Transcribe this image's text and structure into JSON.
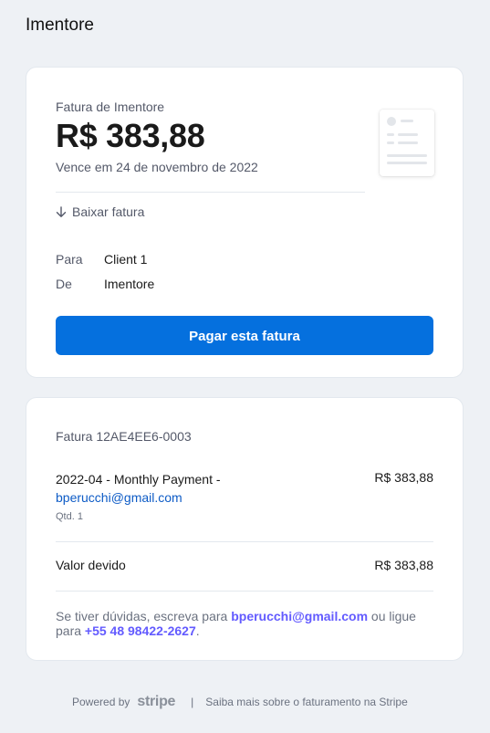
{
  "brand": {
    "name": "Imentore"
  },
  "summary": {
    "invoice_label": "Fatura de Imentore",
    "amount": "R$ 383,88",
    "due_text": "Vence em 24 de novembro de 2022",
    "download_label": "Baixar fatura",
    "to_label": "Para",
    "to_value": "Client 1",
    "from_label": "De",
    "from_value": "Imentore",
    "pay_button": "Pagar esta fatura"
  },
  "details": {
    "invoice_number": "Fatura 12AE4EE6-0003",
    "item_title": "2022-04 - Monthly Payment -",
    "item_email": "bperucchi@gmail.com",
    "item_qty": "Qtd. 1",
    "item_price": "R$ 383,88",
    "due_label": "Valor devido",
    "due_value": "R$ 383,88",
    "help_prefix": "Se tiver dúvidas, escreva para",
    "help_email": "bperucchi@gmail.com",
    "help_middle": "ou ligue para",
    "help_phone": "+55 48 98422-2627",
    "help_suffix": "."
  },
  "footer": {
    "powered_by": "Powered by",
    "stripe": "stripe",
    "separator": "|",
    "learn_more": "Saiba mais sobre o faturamento na Stripe"
  },
  "colors": {
    "background": "#eef1f5",
    "accent": "#0570de",
    "link": "#635bff",
    "email": "#0d5bc6"
  }
}
